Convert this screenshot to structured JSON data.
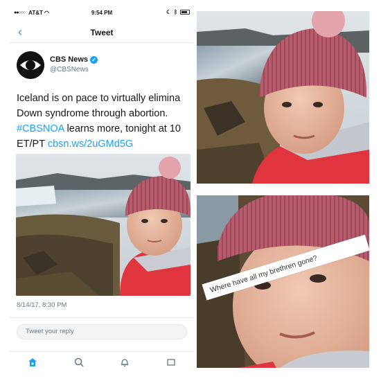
{
  "status_bar": {
    "carrier": "AT&T",
    "time": "9:54 PM"
  },
  "nav": {
    "title": "Tweet",
    "back_icon": "chevron-left-icon"
  },
  "tweet": {
    "author_name": "CBS News",
    "handle": "@CBSNews",
    "text_line1": "Iceland is on pace to virtually elimina",
    "text_line2": "Down syndrome through abortion.",
    "text_line3_hashtag": "#CBSNOA",
    "text_line3_rest": " learns more, tonight at 10",
    "text_line4_plain": "ET/PT ",
    "text_line4_link": "cbsn.ws/2uGMd5G",
    "date": "8/14/17, 8:30 PM"
  },
  "reply": {
    "placeholder": "Tweet your reply"
  },
  "tab_bar": {
    "items": [
      "home-icon",
      "search-icon",
      "notifications-icon",
      "messages-icon"
    ]
  },
  "meme_caption": "Where have all my brethren gone?",
  "colors": {
    "twitter_blue": "#1da1f2",
    "hat_pink": "#b45b6b",
    "jacket_red": "#e0343f"
  }
}
